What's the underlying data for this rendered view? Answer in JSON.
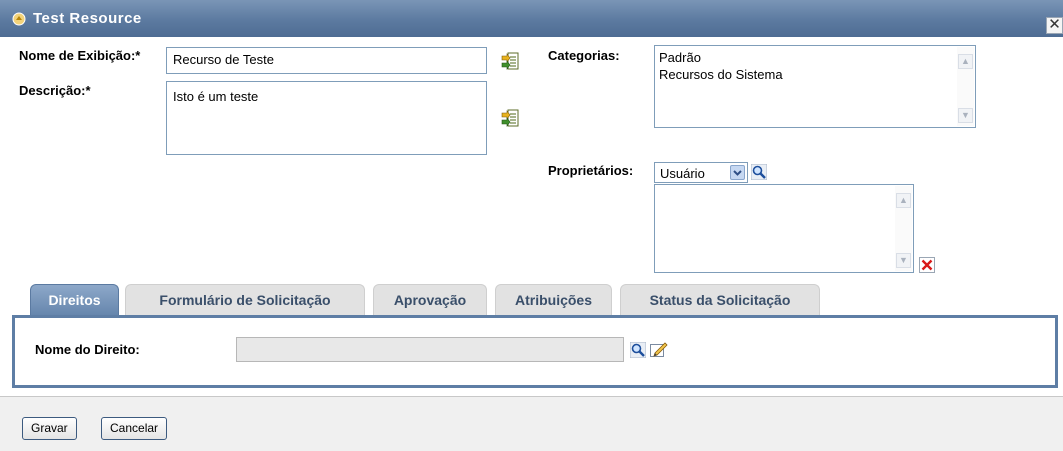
{
  "window": {
    "title": "Test Resource",
    "close_glyph": "✕"
  },
  "form": {
    "display_name_label": "Nome de Exibição:*",
    "display_name_value": "Recurso de Teste",
    "description_label": "Descrição:*",
    "description_value": "Isto é um teste",
    "categories_label": "Categorias:",
    "categories": [
      "Padrão",
      "Recursos do Sistema"
    ],
    "owners_label": "Proprietários:",
    "owner_type_selected": "Usuário"
  },
  "tabs": [
    {
      "label": "Direitos",
      "active": true
    },
    {
      "label": "Formulário de Solicitação",
      "active": false
    },
    {
      "label": "Aprovação",
      "active": false
    },
    {
      "label": "Atribuições",
      "active": false
    },
    {
      "label": "Status da Solicitação",
      "active": false
    }
  ],
  "rights_panel": {
    "right_name_label": "Nome do Direito:",
    "right_name_value": ""
  },
  "footer": {
    "save_label": "Gravar",
    "cancel_label": "Cancelar"
  },
  "icons": {
    "localize": "localize-icon",
    "search": "magnifier-icon",
    "edit": "edit-pencil-icon",
    "remove": "red-x-icon",
    "title": "resource-icon"
  },
  "colors": {
    "title_bar": "#5c7aa0",
    "tab_active": "#6686ad",
    "panel_border": "#5e7ea5",
    "remove_icon": "#d81818"
  }
}
